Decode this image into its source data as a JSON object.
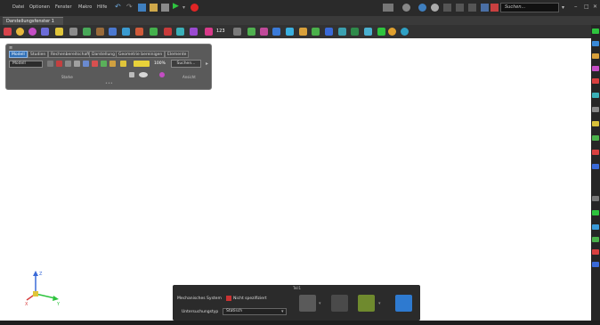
{
  "menu": [
    "Datei",
    "Optionen",
    "Fenster",
    "Makro",
    "Hilfe"
  ],
  "search": {
    "placeholder": "Suchen..."
  },
  "document_tab": "Darstellungsfenster 1",
  "toolbar": {
    "zoom_value": "123"
  },
  "panel": {
    "tabs": [
      "Modell",
      "Studien",
      "Rechenbereitschaft",
      "Darstellung",
      "Geometrie bereinigen",
      "Elemente"
    ],
    "active_tab": "Modell",
    "model_select": "Modell",
    "percent": "100%",
    "search_button": "Suchen...",
    "group_left": "Starke",
    "group_right": "Ansicht"
  },
  "triad": {
    "z": "Z",
    "x": "X",
    "y": "Y"
  },
  "bottom_panel": {
    "title": "Teil1",
    "mech_system_label": "Mechanisches System",
    "mech_system_value": "Nicht spezifiziert",
    "analysis_type_label": "Untersuchungstyp",
    "analysis_type_value": "Statisch"
  },
  "colors": {
    "menubar_bg": "#2a2a2a",
    "panel_bg": "#5a5a5a",
    "active_tab": "#2f6fb6",
    "canvas_bg": "#ffffff",
    "run_green": "#2ec43e",
    "stop_red": "#e02525"
  }
}
